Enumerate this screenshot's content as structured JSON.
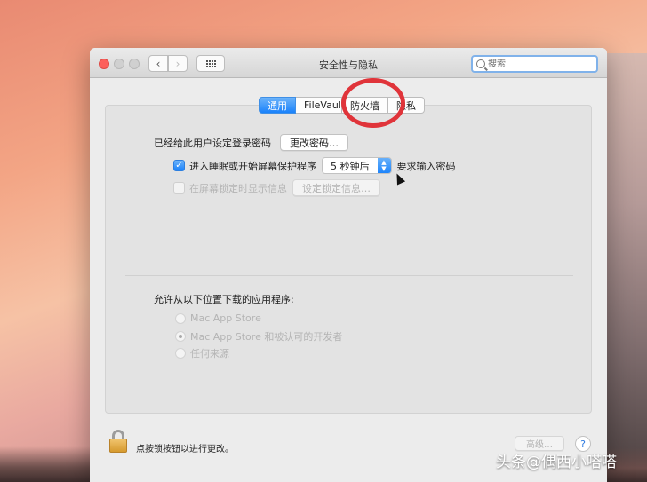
{
  "window": {
    "title": "安全性与隐私",
    "search_placeholder": "搜索"
  },
  "tabs": [
    {
      "label": "通用",
      "active": true
    },
    {
      "label": "FileVault",
      "active": false
    },
    {
      "label": "防火墙",
      "active": false
    },
    {
      "label": "隐私",
      "active": false
    }
  ],
  "general": {
    "password_label": "已经给此用户设定登录密码",
    "change_password_button": "更改密码…",
    "require_password_label": "进入睡眠或开始屏幕保护程序",
    "require_password_checked": true,
    "require_password_delay": "5 秒钟后",
    "require_password_suffix": "要求输入密码",
    "show_message_label": "在屏幕锁定时显示信息",
    "show_message_checked": false,
    "set_lock_message_button": "设定锁定信息…"
  },
  "downloads": {
    "heading": "允许从以下位置下载的应用程序:",
    "options": [
      {
        "label": "Mac App Store",
        "selected": false
      },
      {
        "label": "Mac App Store 和被认可的开发者",
        "selected": true
      },
      {
        "label": "任何来源",
        "selected": false
      }
    ]
  },
  "footer": {
    "lock_text": "点按锁按钮以进行更改。",
    "advanced_button": "高级…",
    "help_button": "?"
  },
  "watermark": "头条@偶西小嗒嗒",
  "colors": {
    "accent": "#1a82fb",
    "annotation_circle": "#e0343a",
    "close_button": "#fc605c"
  },
  "icons": {
    "close": "close-icon",
    "back": "chevron-left-icon",
    "forward": "chevron-right-icon",
    "grid": "grid-icon",
    "search": "search-icon",
    "lock": "lock-icon",
    "help": "help-icon",
    "cursor": "cursor-icon"
  }
}
